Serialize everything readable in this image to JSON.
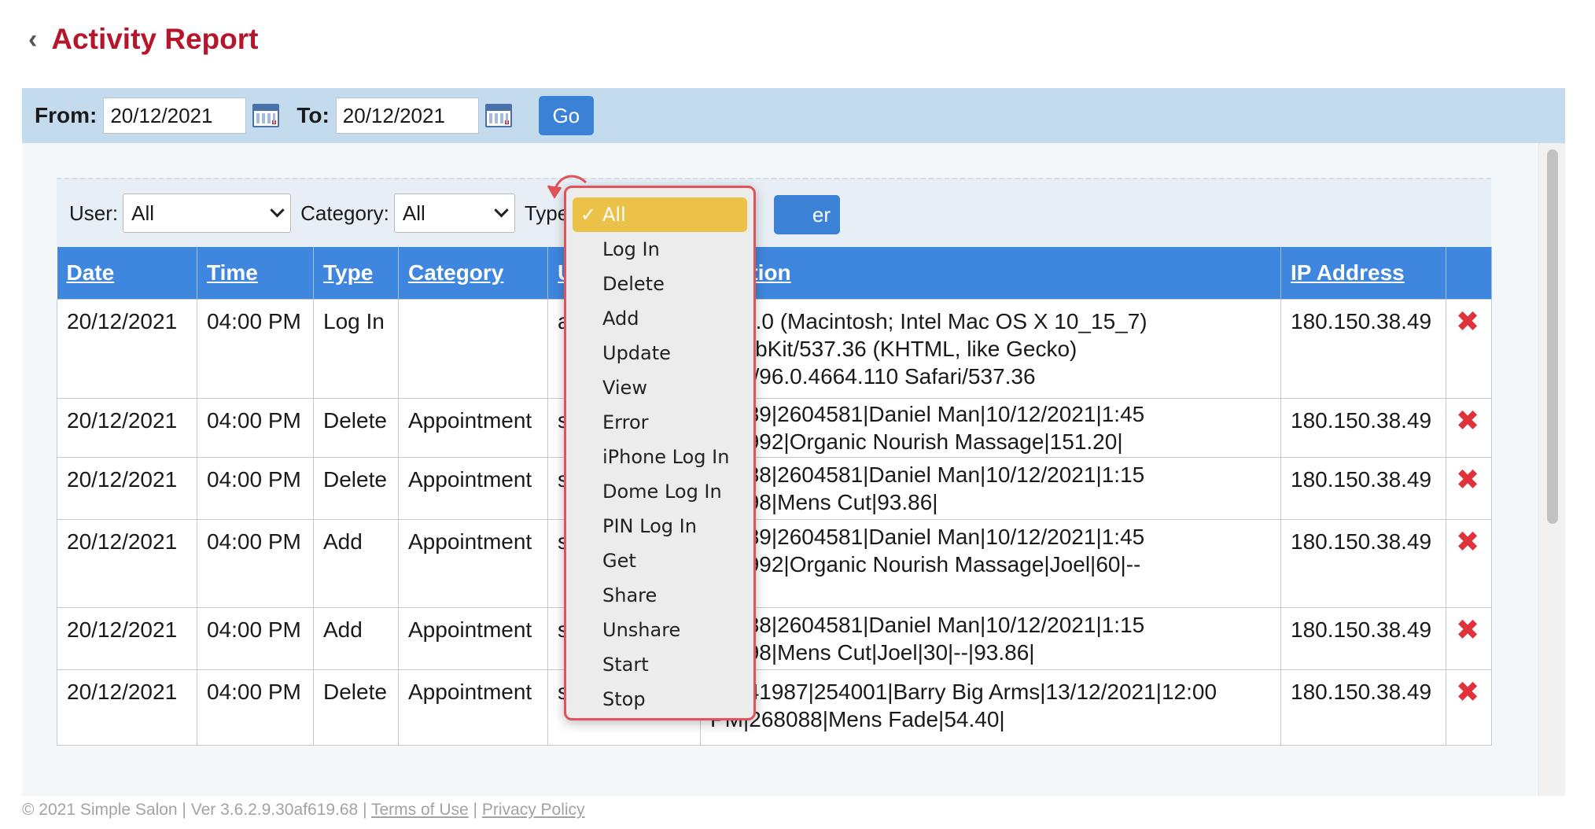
{
  "header": {
    "back_icon": "chevron-left-icon",
    "title": "Activity Report"
  },
  "date_filter": {
    "from_label": "From:",
    "from_value": "20/12/2021",
    "to_label": "To:",
    "to_value": "20/12/2021",
    "go_label": "Go"
  },
  "filters": {
    "user_label": "User:",
    "user_value": "All",
    "category_label": "Category:",
    "category_value": "All",
    "type_label": "Type",
    "filter_button_label": "er"
  },
  "type_dropdown": {
    "items": [
      "All",
      "Log In",
      "Delete",
      "Add",
      "Update",
      "View",
      "Error",
      "iPhone Log In",
      "Dome Log In",
      "PIN Log In",
      "Get",
      "Share",
      "Unshare",
      "Start",
      "Stop"
    ],
    "selected": "All"
  },
  "table": {
    "headers": [
      "Date",
      "Time",
      "Type",
      "Category",
      "U",
      "cription",
      "IP Address"
    ],
    "rows": [
      {
        "date": "20/12/2021",
        "time": "04:00 PM",
        "type": "Log In",
        "category": "",
        "user": "a",
        "desc": [
          "illa/5.0 (Macintosh; Intel Mac OS X 10_15_7)",
          "eWebKit/537.36 (KHTML, like Gecko)",
          "ome/96.0.4664.110 Safari/537.36"
        ],
        "ip": "180.150.38.49"
      },
      {
        "date": "20/12/2021",
        "time": "04:00 PM",
        "type": "Delete",
        "category": "Appointment",
        "user": "s",
        "desc": [
          "41989|2604581|Daniel Man|10/12/2021|1:45",
          "267992|Organic Nourish Massage|151.20|"
        ],
        "ip": "180.150.38.49"
      },
      {
        "date": "20/12/2021",
        "time": "04:00 PM",
        "type": "Delete",
        "category": "Appointment",
        "user": "s",
        "desc": [
          "41988|2604581|Daniel Man|10/12/2021|1:15",
          "46198|Mens Cut|93.86|"
        ],
        "ip": "180.150.38.49"
      },
      {
        "date": "20/12/2021",
        "time": "04:00 PM",
        "type": "Add",
        "category": "Appointment",
        "user": "s",
        "desc": [
          "41989|2604581|Daniel Man|10/12/2021|1:45",
          "267992|Organic Nourish Massage|Joel|60|--",
          ".20|"
        ],
        "ip": "180.150.38.49"
      },
      {
        "date": "20/12/2021",
        "time": "04:00 PM",
        "type": "Add",
        "category": "Appointment",
        "user": "s",
        "desc": [
          "41988|2604581|Daniel Man|10/12/2021|1:15",
          "46198|Mens Cut|Joel|30|--|93.86|"
        ],
        "ip": "180.150.38.49"
      },
      {
        "date": "20/12/2021",
        "time": "04:00 PM",
        "type": "Delete",
        "category": "Appointment",
        "user": "staff",
        "desc": [
          "35341987|254001|Barry Big Arms|13/12/2021|12:00",
          "PM|268088|Mens Fade|54.40|"
        ],
        "ip": "180.150.38.49"
      }
    ],
    "delete_icon": "close-icon"
  },
  "footer": {
    "copyright": "© 2021 Simple Salon | Ver 3.6.2.9.30af619.68 |",
    "terms": "Terms of Use",
    "separator": "|",
    "privacy": "Privacy Policy"
  },
  "colors": {
    "title": "#b5162b",
    "accent": "#3b82d6",
    "table_header": "#3f86de",
    "dropdown_selected": "#ecc147",
    "dropdown_border": "#e0535a",
    "delete": "#e0323a"
  }
}
